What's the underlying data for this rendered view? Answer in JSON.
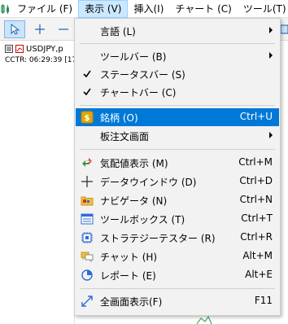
{
  "menubar": {
    "items": [
      "ファイル (F)",
      "表示 (V)",
      "挿入(I)",
      "チャート (C)",
      "ツール(T)"
    ]
  },
  "chart": {
    "symbol": "USDJPY,p",
    "info": "CCTR: 06:29:39 [17"
  },
  "menu": {
    "items": [
      {
        "label": "言語 (L)",
        "shortcut": "",
        "submenu": true,
        "icon": "none"
      },
      {
        "label": "ツールバー (B)",
        "shortcut": "",
        "submenu": true,
        "icon": "none"
      },
      {
        "label": "ステータスバー (S)",
        "shortcut": "",
        "submenu": false,
        "icon": "check-icon"
      },
      {
        "label": "チャートバー (C)",
        "shortcut": "",
        "submenu": false,
        "icon": "check-icon"
      },
      {
        "label": "銘柄 (O)",
        "shortcut": "Ctrl+U",
        "submenu": false,
        "icon": "dollar-icon"
      },
      {
        "label": "板注文画面",
        "shortcut": "",
        "submenu": true,
        "icon": "none"
      },
      {
        "label": "気配値表示 (M)",
        "shortcut": "Ctrl+M",
        "submenu": false,
        "icon": "market-watch-icon"
      },
      {
        "label": "データウインドウ (D)",
        "shortcut": "Ctrl+D",
        "submenu": false,
        "icon": "crosshair-icon"
      },
      {
        "label": "ナビゲータ (N)",
        "shortcut": "Ctrl+N",
        "submenu": false,
        "icon": "folder-icon"
      },
      {
        "label": "ツールボックス (T)",
        "shortcut": "Ctrl+T",
        "submenu": false,
        "icon": "toolbox-icon"
      },
      {
        "label": "ストラテジーテスター (R)",
        "shortcut": "Ctrl+R",
        "submenu": false,
        "icon": "chip-icon"
      },
      {
        "label": "チャット (H)",
        "shortcut": "Alt+M",
        "submenu": false,
        "icon": "chat-icon"
      },
      {
        "label": "レポート (E)",
        "shortcut": "Alt+E",
        "submenu": false,
        "icon": "report-icon"
      },
      {
        "label": "全画面表示(F)",
        "shortcut": "F11",
        "submenu": false,
        "icon": "fullscreen-icon"
      }
    ]
  },
  "colors": {
    "selected": "#0078d7",
    "menu_bg": "#f2f2f2",
    "menubar_active": "#cce8ff"
  }
}
